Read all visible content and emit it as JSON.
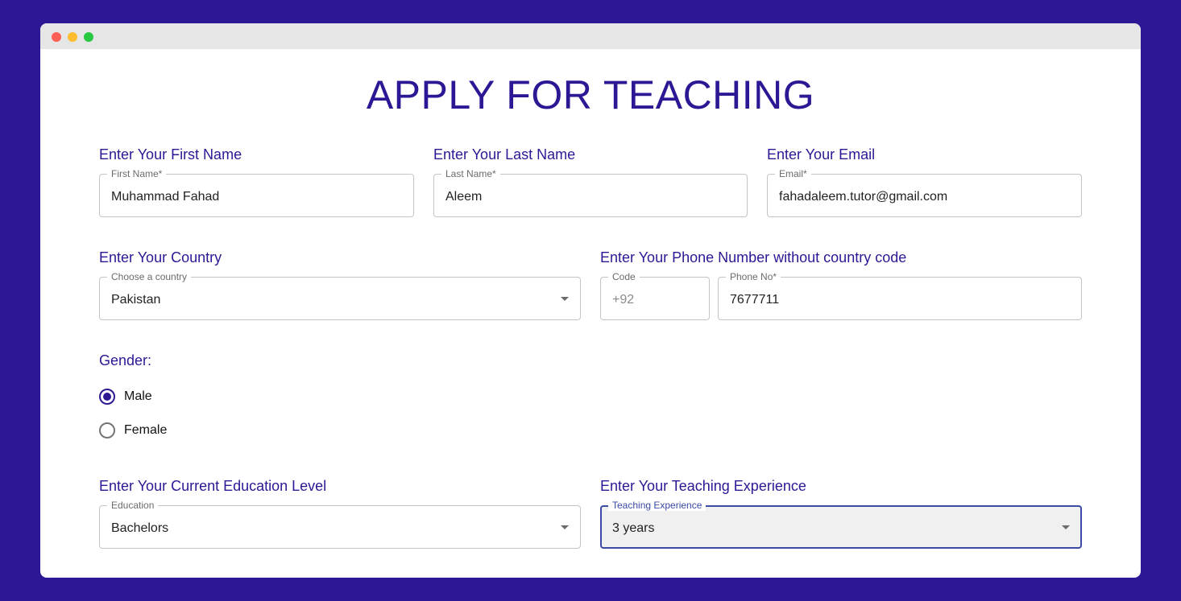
{
  "page": {
    "title": "APPLY FOR TEACHING"
  },
  "first_name": {
    "heading": "Enter Your First Name",
    "legend": "First Name*",
    "value": "Muhammad Fahad"
  },
  "last_name": {
    "heading": "Enter Your Last Name",
    "legend": "Last Name*",
    "value": "Aleem"
  },
  "email": {
    "heading": "Enter Your Email",
    "legend": "Email*",
    "value": "fahadaleem.tutor@gmail.com"
  },
  "country": {
    "heading": "Enter Your Country",
    "legend": "Choose a country",
    "value": "Pakistan"
  },
  "phone": {
    "heading": "Enter Your Phone Number without country code",
    "code_legend": "Code",
    "code_value": "+92",
    "number_legend": "Phone No*",
    "number_value": "7677711"
  },
  "gender": {
    "heading": "Gender:",
    "options": [
      {
        "label": "Male",
        "checked": true
      },
      {
        "label": "Female",
        "checked": false
      }
    ]
  },
  "education": {
    "heading": "Enter Your Current Education Level",
    "legend": "Education",
    "value": "Bachelors"
  },
  "experience": {
    "heading": "Enter Your Teaching Experience",
    "legend": "Teaching Experience",
    "value": "3 years"
  },
  "colors": {
    "brand": "#2e1795",
    "focus": "#3a4aa5",
    "border": "#c4c4c4"
  },
  "icons": {
    "dropdown": "caret-down-icon"
  }
}
